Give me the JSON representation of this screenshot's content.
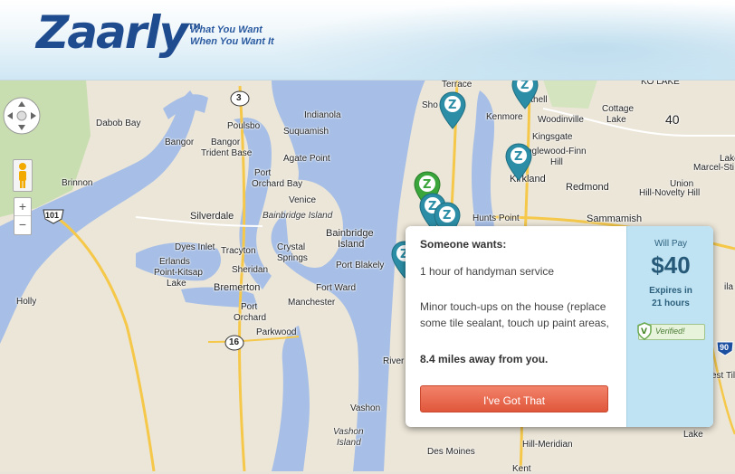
{
  "header": {
    "logo_text": "Zaarly",
    "logo_tm": "TM",
    "tagline_line1": "What You Want",
    "tagline_line2": "When You Want It"
  },
  "map": {
    "labels": {
      "kenmore": "Kenmore",
      "bothell": "Bothell",
      "woodinville": "Woodinville",
      "cottage": "Cottage",
      "lake": "Lake",
      "kingsgate": "Kingsgate",
      "inglewood": "nglewood-Finn",
      "hill": "Hill",
      "kirkland": "Kirkland",
      "redmond": "Redmond",
      "union": "Union",
      "hillnovelty": "Hill-Novelty Hill",
      "sammamish": "Sammamish",
      "lake2": "Lake",
      "marcel": "Marcel-Sti",
      "hunts": "Hunts Point",
      "sho": "Sho",
      "terrace": "Terrace",
      "dabob": "Dabob Bay",
      "poulsbo": "Poulsbo",
      "indianola": "Indianola",
      "suquamish": "Suquamish",
      "bangor": "Bangor",
      "bangor2": "Bangor",
      "trident": "Trident Base",
      "agate": "Agate Point",
      "brinnon": "Brinnon",
      "port": "Port",
      "orchardbay": "Orchard Bay",
      "venice": "Venice",
      "silverdale": "Silverdale",
      "bainbridge": "Bainbridge Island",
      "bainbridge1": "Bainbridge",
      "bainbridge2": "Island",
      "bainbridgeCity": "Bainbridge",
      "island": "Island",
      "dyes": "Dyes Inlet",
      "tracyton": "Tracyton",
      "crystal": "Crystal",
      "springs": "Springs",
      "erland": "Erlands",
      "point": "Point-Kitsap",
      "lakek": "Lake",
      "sheridan": "Sheridan",
      "portblakely": "Port Blakely",
      "portward": "Fort Ward",
      "holly": "Holly",
      "bremerton": "Bremerton",
      "manchester": "Manchester",
      "portorchard1": "Port",
      "portorchard2": "Orchard",
      "parkwood": "Parkwood",
      "river": "River",
      "vashon": "Vashon",
      "vashon2": "Vashon",
      "island2": "Island",
      "desmoines": "Des Moines",
      "kent": "Kent",
      "hillmeridian": "Hill-Meridian",
      "lakeside": "Lake",
      "estt": "est Til",
      "ila": "ila",
      "kolake": "KO LAKE",
      "route3": "3",
      "route101": "101",
      "route16": "16",
      "route90": "90"
    }
  },
  "controls": {
    "zoom_in": "+",
    "zoom_out": "−"
  },
  "popup": {
    "heading": "Someone wants:",
    "title": "1 hour of handyman service",
    "description": "Minor touch-ups on the house (replace some tile sealant, touch up paint areas,",
    "distance": "8.4 miles away from you.",
    "button_label": "I've Got That",
    "will_pay_label": "Will Pay",
    "price": "$40",
    "expires_line1": "Expires in",
    "expires_line2": "21 hours",
    "verified_label": "Verified!"
  },
  "colors": {
    "water": "#a7bfe6",
    "land": "#ece6d8",
    "park": "#c8deb0",
    "accent": "#1f4b8f",
    "button": "#e0573b",
    "marker_teal": "#2c8ea6",
    "marker_green": "#3aa53a"
  }
}
